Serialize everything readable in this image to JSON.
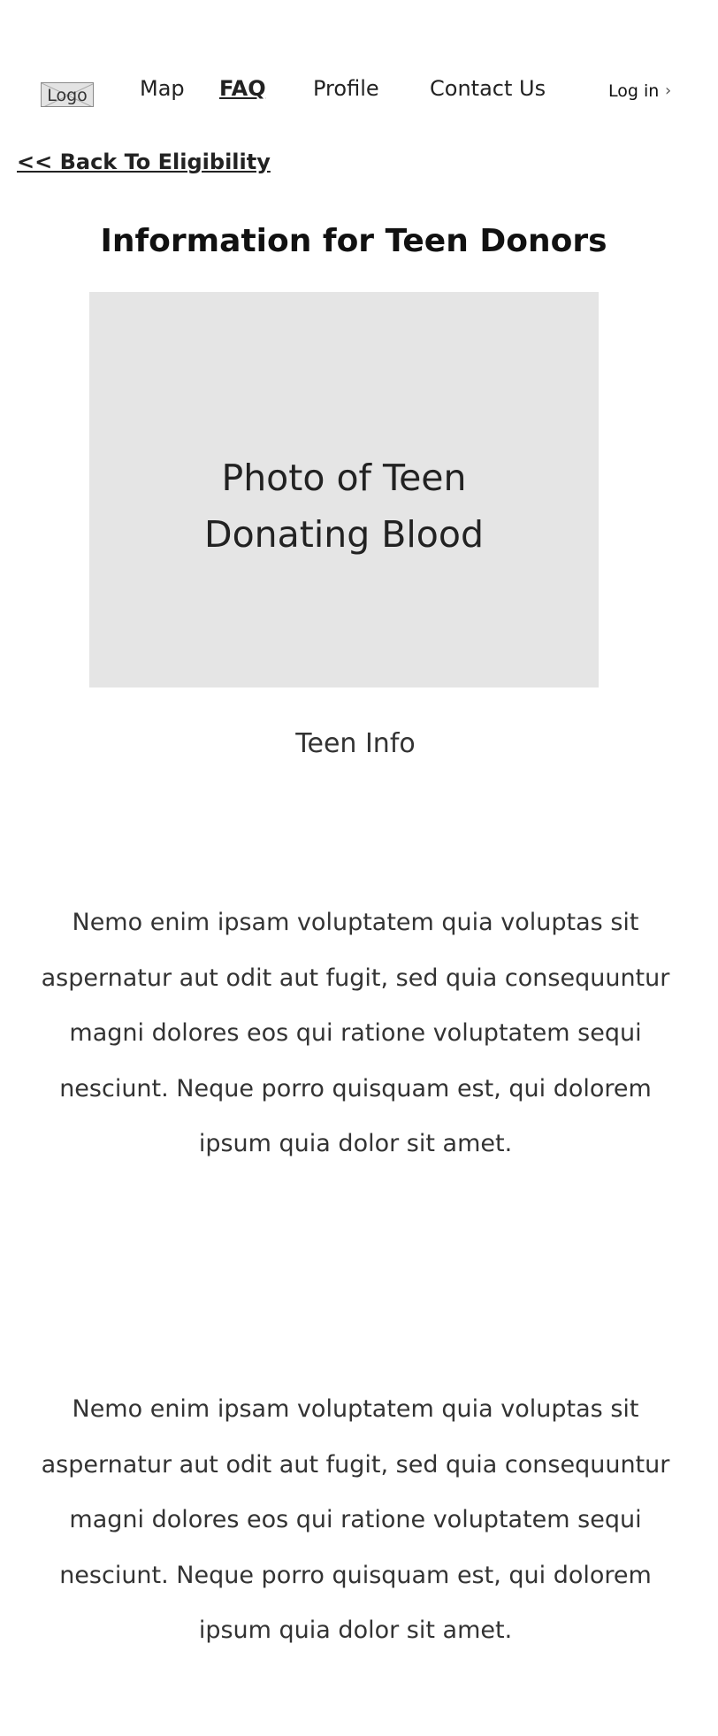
{
  "nav": {
    "logo_label": "Logo",
    "links": [
      {
        "label": "Map",
        "active": false
      },
      {
        "label": "FAQ",
        "active": true
      },
      {
        "label": "Profile",
        "active": false
      },
      {
        "label": "Contact Us",
        "active": false
      }
    ],
    "login_label": "Log in",
    "login_icon": "chevron-right-icon"
  },
  "back_link": "<< Back To Eligibility",
  "page_title": "Information for Teen Donors",
  "photo": {
    "caption_line1": "Photo of Teen",
    "caption_line2": "Donating Blood"
  },
  "section_heading": "Teen Info",
  "paragraphs": [
    {
      "lines": [
        "Nemo enim ipsam voluptatem quia voluptas sit",
        "aspernatur aut odit aut fugit, sed quia consequuntur",
        "magni dolores eos qui ratione voluptatem sequi",
        "nesciunt. Neque porro quisquam est, qui dolorem",
        "ipsum quia dolor sit amet."
      ]
    },
    {
      "lines": [
        "Nemo enim ipsam voluptatem quia voluptas sit",
        "aspernatur aut odit aut fugit, sed quia consequuntur",
        "magni dolores eos qui ratione voluptatem sequi",
        "nesciunt. Neque porro quisquam est, qui dolorem",
        "ipsum quia dolor sit amet."
      ]
    }
  ],
  "colors": {
    "placeholder_bg": "#e5e5e5",
    "text": "#222222"
  }
}
